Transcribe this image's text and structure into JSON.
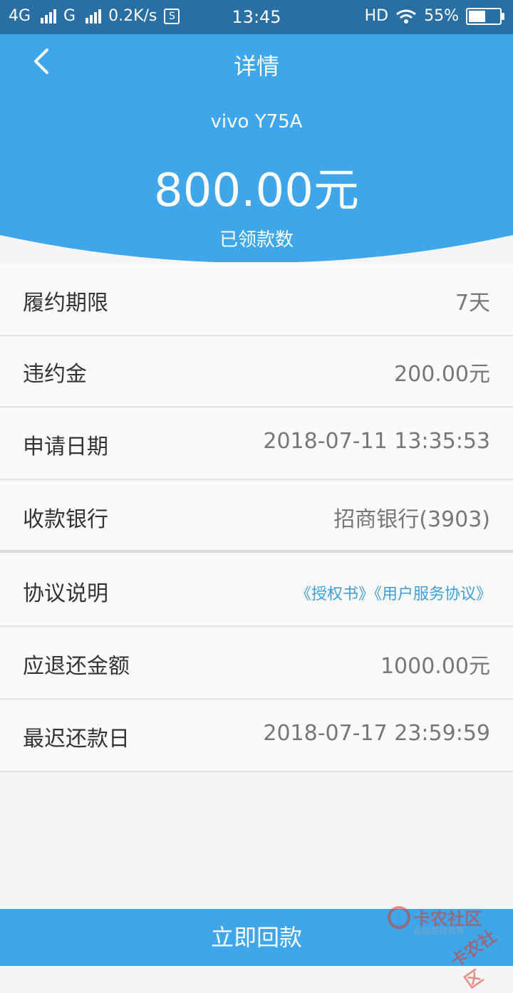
{
  "status_bar": {
    "network1": "4G",
    "network2": "G",
    "speed": "0.2K/s",
    "s_icon_text": "S",
    "time": "13:45",
    "hd": "HD",
    "battery_percent": "55%",
    "battery_level": 0.55
  },
  "header": {
    "title": "详情",
    "device": "vivo Y75A",
    "amount": "800.00元",
    "subtitle": "已领款数",
    "color": "#3fa6ea"
  },
  "details": [
    {
      "label": "履约期限",
      "value": "7天"
    },
    {
      "label": "违约金",
      "value": "200.00元"
    },
    {
      "label": "申请日期",
      "value": "2018-07-11 13:35:53"
    },
    {
      "label": "收款银行",
      "value": "招商银行(3903)"
    },
    {
      "label": "协议说明",
      "links": "《授权书》《用户服务协议》"
    },
    {
      "label": "应退还金额",
      "value": "1000.00元"
    },
    {
      "label": "最迟还款日",
      "value": "2018-07-17 23:59:59"
    }
  ],
  "footer": {
    "button_label": "立即回款"
  },
  "watermark": {
    "name": "卡农社区",
    "tagline": "金融在线教育",
    "stamp": "卡农社区"
  },
  "icons": {
    "back": "chevron-left-icon",
    "wifi": "wifi-icon",
    "battery": "battery-icon"
  }
}
